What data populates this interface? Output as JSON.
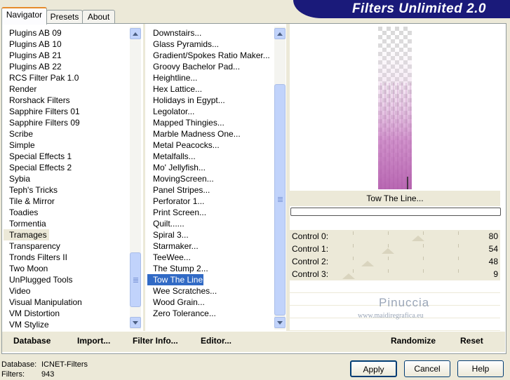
{
  "window_title": "Filters Unlimited 2.0",
  "tabs": [
    {
      "label": "Navigator"
    },
    {
      "label": "Presets"
    },
    {
      "label": "About"
    }
  ],
  "categories": {
    "items": [
      "Plugins AB 09",
      "Plugins AB 10",
      "Plugins AB 21",
      "Plugins AB 22",
      "RCS Filter Pak 1.0",
      "Render",
      "Rorshack Filters",
      "Sapphire Filters 01",
      "Sapphire Filters 09",
      "Scribe",
      "Simple",
      "Special Effects 1",
      "Special Effects 2",
      "Sybia",
      "Teph's Tricks",
      "Tile & Mirror",
      "Toadies",
      "Tormentia",
      "Tramages",
      "Transparency",
      "Tronds Filters II",
      "Two Moon",
      "UnPlugged Tools",
      "Video",
      "Visual Manipulation",
      "VM Distortion",
      "VM Stylize"
    ],
    "selected": "Tramages"
  },
  "filters": {
    "items": [
      "Downstairs...",
      "Glass Pyramids...",
      "Gradient/Spokes Ratio Maker...",
      "Groovy Bachelor Pad...",
      "Heightline...",
      "Hex Lattice...",
      "Holidays in Egypt...",
      "Legolator...",
      "Mapped Thingies...",
      "Marble Madness One...",
      "Metal Peacocks...",
      "Metalfalls...",
      "Mo' Jellyfish...",
      "MovingScreen...",
      "Panel Stripes...",
      "Perforator 1...",
      "Print Screen...",
      "Quilt......",
      "Spiral 3...",
      "Starmaker...",
      "TeeWee...",
      "The Stump 2...",
      "Tow The Line...",
      "Wee Scratches...",
      "Wood Grain...",
      "Zero Tolerance..."
    ],
    "selected": "Tow The Line..."
  },
  "bottom_links": {
    "database": "Database",
    "import": "Import...",
    "filter_info": "Filter Info...",
    "editor": "Editor...",
    "randomize": "Randomize",
    "reset": "Reset"
  },
  "preview": {
    "filter_name": "Tow The Line...",
    "progress": 0
  },
  "controls": [
    {
      "label": "Control 0:",
      "value": "80"
    },
    {
      "label": "Control 1:",
      "value": "54"
    },
    {
      "label": "Control 2:",
      "value": "48"
    },
    {
      "label": "Control 3:",
      "value": "9"
    }
  ],
  "watermark": {
    "name": "Pinuccia",
    "url": "www.maidiregrafica.eu"
  },
  "status": {
    "database_label": "Database:",
    "database_value": "ICNET-Filters",
    "filters_label": "Filters:",
    "filters_value": "943"
  },
  "buttons": {
    "apply": "Apply",
    "cancel": "Cancel",
    "help": "Help"
  },
  "colors": {
    "title_bar": "#1a1a7a",
    "selection": "#316ac5",
    "preview_stripes": "#c47fbf"
  }
}
